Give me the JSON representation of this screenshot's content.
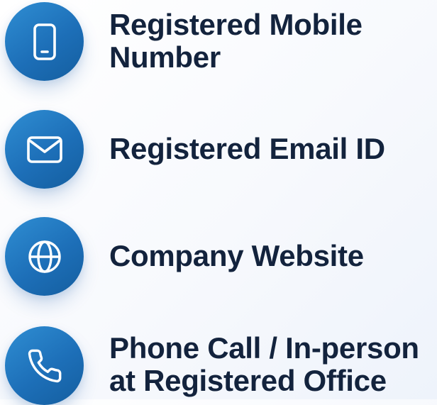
{
  "channels": [
    {
      "id": "mobile",
      "icon": "mobile-phone-icon",
      "lines": [
        "Registered Mobile",
        "Number"
      ]
    },
    {
      "id": "email",
      "icon": "envelope-icon",
      "lines": [
        "Registered Email ID"
      ]
    },
    {
      "id": "website",
      "icon": "globe-icon",
      "lines": [
        "Company Website"
      ]
    },
    {
      "id": "phone",
      "icon": "phone-handset-icon",
      "lines": [
        "Phone Call / In-person",
        "at Registered Office"
      ]
    }
  ],
  "colors": {
    "icon_circle": "#1d6fb8",
    "icon_circle_light": "#2f8ed3",
    "text": "#13233d",
    "icon_glyph": "#ffffff"
  }
}
